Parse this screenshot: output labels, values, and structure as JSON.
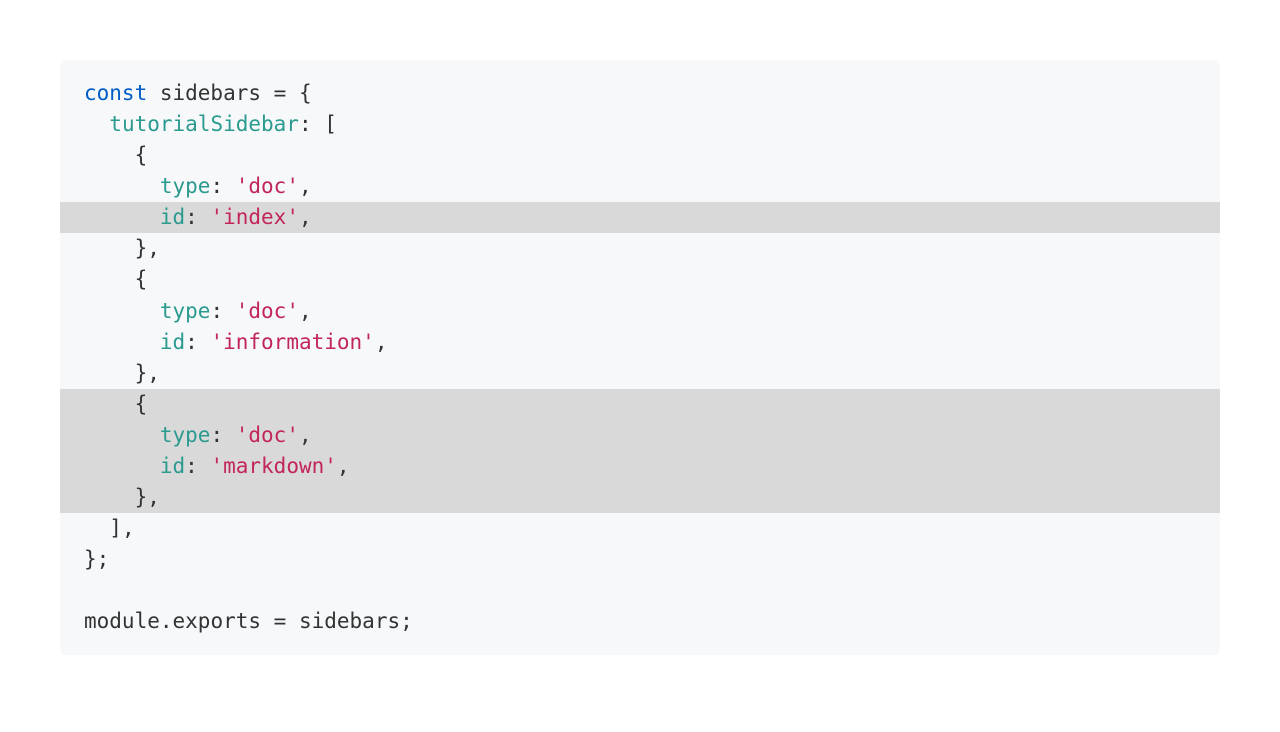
{
  "code": {
    "lines": [
      {
        "highlight": false,
        "first": true,
        "tokens": [
          {
            "cls": "tok-keyword",
            "t": "const"
          },
          {
            "cls": "tok-plain",
            "t": " sidebars "
          },
          {
            "cls": "tok-punct",
            "t": "="
          },
          {
            "cls": "tok-plain",
            "t": " "
          },
          {
            "cls": "tok-punct",
            "t": "{"
          }
        ]
      },
      {
        "highlight": false,
        "tokens": [
          {
            "cls": "tok-plain",
            "t": "  "
          },
          {
            "cls": "tok-prop",
            "t": "tutorialSidebar"
          },
          {
            "cls": "tok-punct",
            "t": ":"
          },
          {
            "cls": "tok-plain",
            "t": " "
          },
          {
            "cls": "tok-punct",
            "t": "["
          }
        ]
      },
      {
        "highlight": false,
        "tokens": [
          {
            "cls": "tok-plain",
            "t": "    "
          },
          {
            "cls": "tok-punct",
            "t": "{"
          }
        ]
      },
      {
        "highlight": false,
        "tokens": [
          {
            "cls": "tok-plain",
            "t": "      "
          },
          {
            "cls": "tok-prop",
            "t": "type"
          },
          {
            "cls": "tok-punct",
            "t": ":"
          },
          {
            "cls": "tok-plain",
            "t": " "
          },
          {
            "cls": "tok-string",
            "t": "'doc'"
          },
          {
            "cls": "tok-punct",
            "t": ","
          }
        ]
      },
      {
        "highlight": true,
        "tokens": [
          {
            "cls": "tok-plain",
            "t": "      "
          },
          {
            "cls": "tok-prop",
            "t": "id"
          },
          {
            "cls": "tok-punct",
            "t": ":"
          },
          {
            "cls": "tok-plain",
            "t": " "
          },
          {
            "cls": "tok-string",
            "t": "'index'"
          },
          {
            "cls": "tok-punct",
            "t": ","
          }
        ]
      },
      {
        "highlight": false,
        "tokens": [
          {
            "cls": "tok-plain",
            "t": "    "
          },
          {
            "cls": "tok-punct",
            "t": "},"
          }
        ]
      },
      {
        "highlight": false,
        "tokens": [
          {
            "cls": "tok-plain",
            "t": "    "
          },
          {
            "cls": "tok-punct",
            "t": "{"
          }
        ]
      },
      {
        "highlight": false,
        "tokens": [
          {
            "cls": "tok-plain",
            "t": "      "
          },
          {
            "cls": "tok-prop",
            "t": "type"
          },
          {
            "cls": "tok-punct",
            "t": ":"
          },
          {
            "cls": "tok-plain",
            "t": " "
          },
          {
            "cls": "tok-string",
            "t": "'doc'"
          },
          {
            "cls": "tok-punct",
            "t": ","
          }
        ]
      },
      {
        "highlight": false,
        "tokens": [
          {
            "cls": "tok-plain",
            "t": "      "
          },
          {
            "cls": "tok-prop",
            "t": "id"
          },
          {
            "cls": "tok-punct",
            "t": ":"
          },
          {
            "cls": "tok-plain",
            "t": " "
          },
          {
            "cls": "tok-string",
            "t": "'information'"
          },
          {
            "cls": "tok-punct",
            "t": ","
          }
        ]
      },
      {
        "highlight": false,
        "tokens": [
          {
            "cls": "tok-plain",
            "t": "    "
          },
          {
            "cls": "tok-punct",
            "t": "},"
          }
        ]
      },
      {
        "highlight": true,
        "tokens": [
          {
            "cls": "tok-plain",
            "t": "    "
          },
          {
            "cls": "tok-punct",
            "t": "{"
          }
        ]
      },
      {
        "highlight": true,
        "tokens": [
          {
            "cls": "tok-plain",
            "t": "      "
          },
          {
            "cls": "tok-prop",
            "t": "type"
          },
          {
            "cls": "tok-punct",
            "t": ":"
          },
          {
            "cls": "tok-plain",
            "t": " "
          },
          {
            "cls": "tok-string",
            "t": "'doc'"
          },
          {
            "cls": "tok-punct",
            "t": ","
          }
        ]
      },
      {
        "highlight": true,
        "tokens": [
          {
            "cls": "tok-plain",
            "t": "      "
          },
          {
            "cls": "tok-prop",
            "t": "id"
          },
          {
            "cls": "tok-punct",
            "t": ":"
          },
          {
            "cls": "tok-plain",
            "t": " "
          },
          {
            "cls": "tok-string",
            "t": "'markdown'"
          },
          {
            "cls": "tok-punct",
            "t": ","
          }
        ]
      },
      {
        "highlight": true,
        "tokens": [
          {
            "cls": "tok-plain",
            "t": "    "
          },
          {
            "cls": "tok-punct",
            "t": "},"
          }
        ]
      },
      {
        "highlight": false,
        "tokens": [
          {
            "cls": "tok-plain",
            "t": "  "
          },
          {
            "cls": "tok-punct",
            "t": "],"
          }
        ]
      },
      {
        "highlight": false,
        "tokens": [
          {
            "cls": "tok-punct",
            "t": "};"
          }
        ]
      },
      {
        "highlight": false,
        "tokens": [
          {
            "cls": "tok-plain",
            "t": " "
          }
        ]
      },
      {
        "highlight": false,
        "last": true,
        "tokens": [
          {
            "cls": "tok-plain",
            "t": "module"
          },
          {
            "cls": "tok-punct",
            "t": "."
          },
          {
            "cls": "tok-plain",
            "t": "exports "
          },
          {
            "cls": "tok-punct",
            "t": "="
          },
          {
            "cls": "tok-plain",
            "t": " sidebars"
          },
          {
            "cls": "tok-punct",
            "t": ";"
          }
        ]
      }
    ]
  }
}
